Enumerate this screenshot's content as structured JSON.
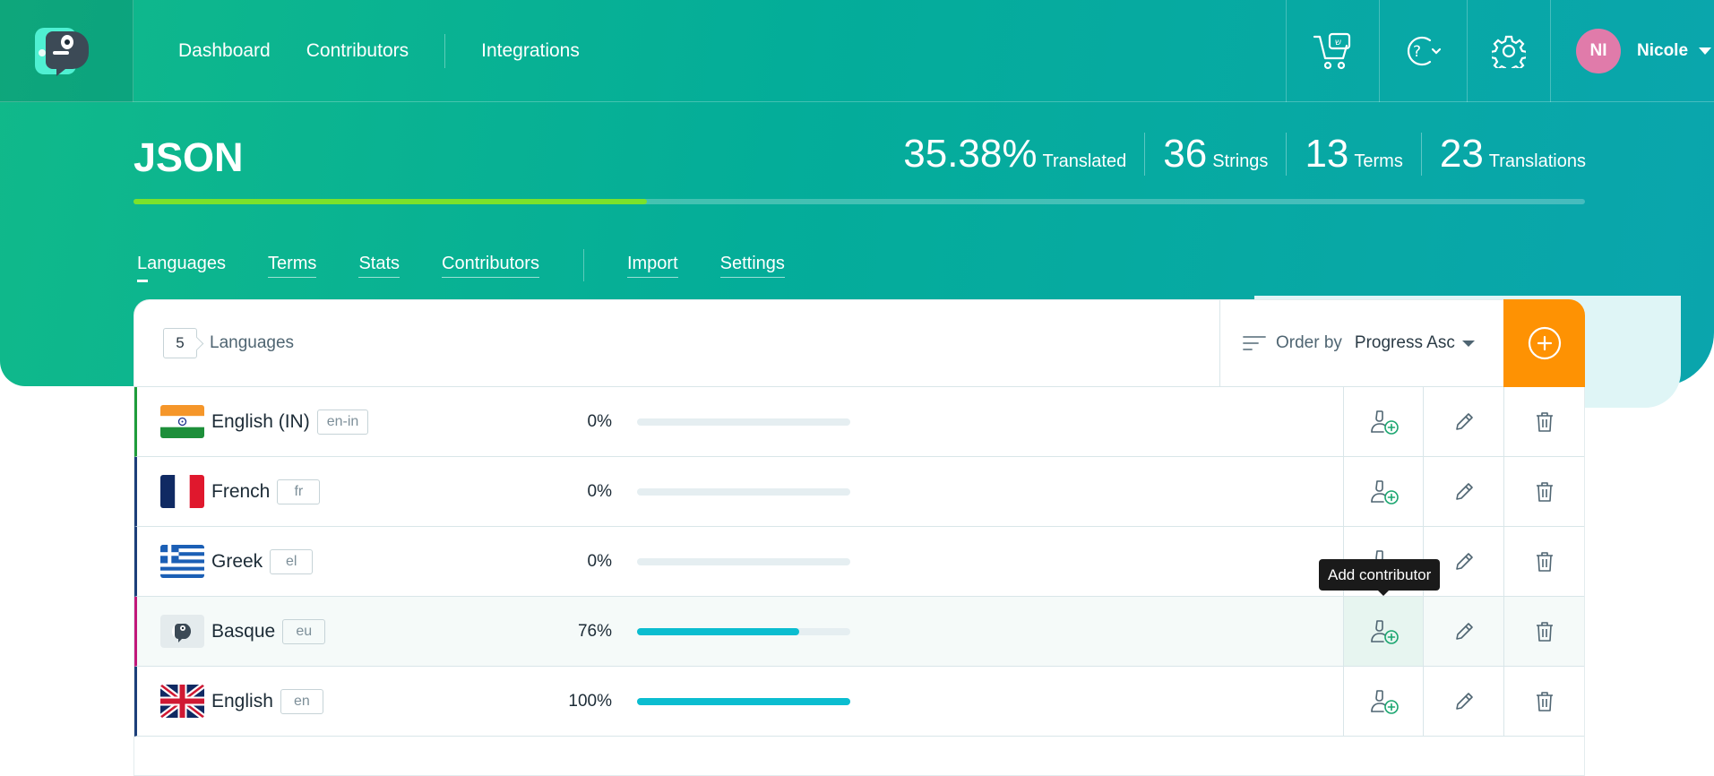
{
  "nav": {
    "links": [
      "Dashboard",
      "Contributors",
      "Integrations"
    ],
    "user": {
      "initials": "NI",
      "name": "Nicole"
    }
  },
  "project": {
    "title": "JSON",
    "stats": [
      {
        "value": "35.38%",
        "label": "Translated"
      },
      {
        "value": "36",
        "label": "Strings"
      },
      {
        "value": "13",
        "label": "Terms"
      },
      {
        "value": "23",
        "label": "Translations"
      }
    ],
    "progress_fraction": 0.3538,
    "tabs": [
      "Languages",
      "Terms",
      "Stats",
      "Contributors",
      "Import",
      "Settings"
    ],
    "active_tab": "Languages"
  },
  "languages_panel": {
    "count": "5",
    "count_label": "Languages",
    "order_label": "Order by",
    "order_value": "Progress Asc",
    "rows": [
      {
        "name": "English (IN)",
        "code": "en-in",
        "percent": "0%",
        "progress": 0,
        "flag": "india-flag",
        "accent": "#1f9d3b"
      },
      {
        "name": "French",
        "code": "fr",
        "percent": "0%",
        "progress": 0,
        "flag": "france-flag",
        "accent": "#1d3f7a"
      },
      {
        "name": "Greek",
        "code": "el",
        "percent": "0%",
        "progress": 0,
        "flag": "greece-flag",
        "accent": "#1d3f7a"
      },
      {
        "name": "Basque",
        "code": "eu",
        "percent": "76%",
        "progress": 0.76,
        "flag": "poeditor-logo-flag",
        "accent": "#c2187a"
      },
      {
        "name": "English",
        "code": "en",
        "percent": "100%",
        "progress": 1,
        "flag": "uk-flag",
        "accent": "#1d3f7a"
      }
    ]
  },
  "tooltip": {
    "text": "Add contributor"
  },
  "colors": {
    "accent_orange": "#fe9203",
    "progress_green": "#7be22b",
    "bar_cyan": "#0bbdd0",
    "avatar_pink": "#e07baa"
  }
}
